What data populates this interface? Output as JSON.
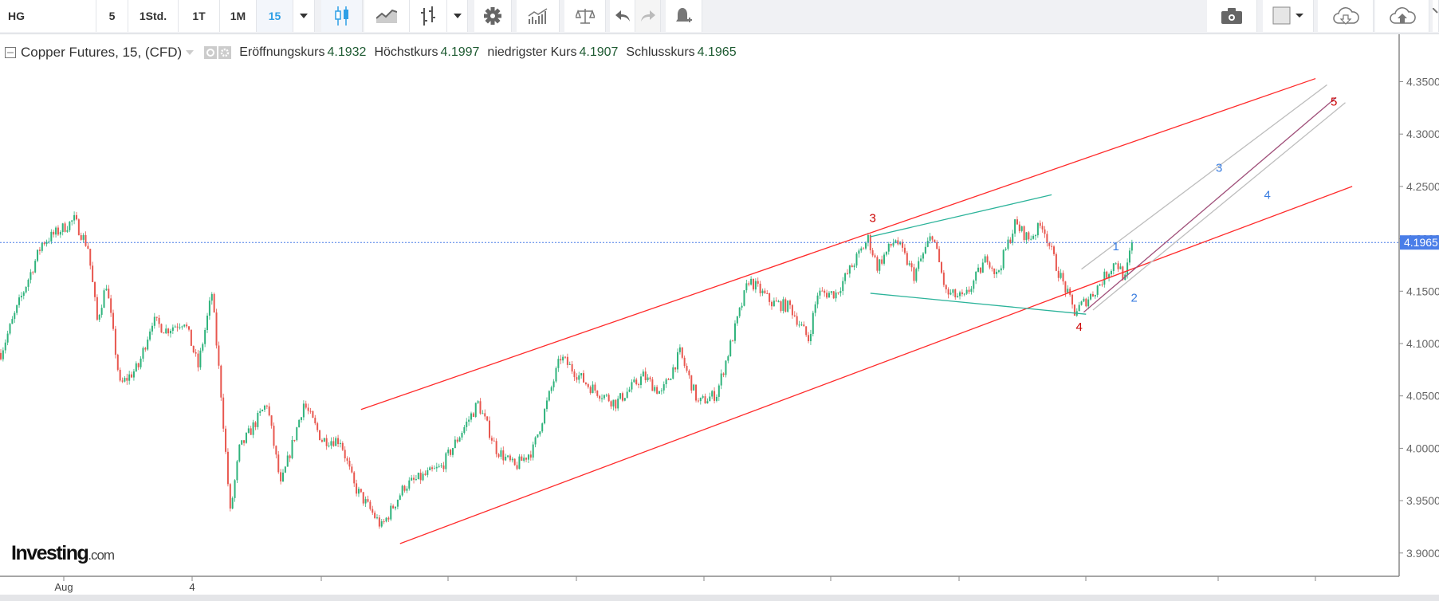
{
  "toolbar": {
    "symbol": "HG",
    "intervals": [
      "5",
      "1Std.",
      "1T",
      "1M",
      "15"
    ],
    "active_interval": "15",
    "icons": [
      "candles-icon",
      "line-chart-icon",
      "bars-icon",
      "gear-icon",
      "indicators-icon",
      "scale-icon",
      "undo-icon",
      "redo-icon",
      "alert-icon",
      "camera-icon",
      "color-icon",
      "cloud-download-icon",
      "cloud-upload-icon",
      "fullscreen-icon"
    ]
  },
  "legend": {
    "title": "Copper Futures, 15, (CFD)",
    "open_label": "Eröffnungskurs",
    "open": "4.1932",
    "high_label": "Höchstkurs",
    "high": "4.1997",
    "low_label": "niedrigster Kurs",
    "low": "4.1907",
    "close_label": "Schlusskurs",
    "close": "4.1965"
  },
  "logo": {
    "main": "Investing",
    "suffix": ".com"
  },
  "colors": {
    "up": "#2fb37c",
    "down": "#e8574f",
    "channel": "#ff2a2a",
    "wedge": "#2bb39a",
    "gray": "#bdbdbd",
    "purple": "#a0507a",
    "current": "#4a7ee8",
    "wave_red": "#cc0000",
    "wave_blue": "#3a7de0"
  },
  "chart_data": {
    "type": "candlestick",
    "title": "Copper Futures, 15, (CFD)",
    "ylim": [
      3.875,
      4.37
    ],
    "yticks": [
      "4.3500",
      "4.3000",
      "4.2500",
      "4.2000",
      "4.1500",
      "4.1000",
      "4.0500",
      "4.0000",
      "3.9500",
      "3.9000"
    ],
    "ytick_values": [
      4.35,
      4.3,
      4.25,
      4.2,
      4.15,
      4.1,
      4.05,
      4.0,
      3.95,
      3.9
    ],
    "xlabels": [
      "Aug",
      "4"
    ],
    "current_price": 4.1965,
    "current_price_label": "4.1965",
    "price_path_approx": [
      [
        0,
        4.091
      ],
      [
        8,
        4.139
      ],
      [
        18,
        4.196
      ],
      [
        32,
        4.218
      ],
      [
        38,
        4.192
      ],
      [
        42,
        4.122
      ],
      [
        46,
        4.157
      ],
      [
        52,
        4.06
      ],
      [
        60,
        4.078
      ],
      [
        66,
        4.122
      ],
      [
        72,
        4.113
      ],
      [
        80,
        4.122
      ],
      [
        86,
        4.078
      ],
      [
        92,
        4.148
      ],
      [
        96,
        4.052
      ],
      [
        100,
        3.938
      ],
      [
        104,
        3.999
      ],
      [
        116,
        4.043
      ],
      [
        122,
        3.964
      ],
      [
        132,
        4.043
      ],
      [
        140,
        4.008
      ],
      [
        148,
        4.008
      ],
      [
        154,
        3.964
      ],
      [
        166,
        3.925
      ],
      [
        176,
        3.964
      ],
      [
        192,
        3.982
      ],
      [
        208,
        4.043
      ],
      [
        216,
        3.999
      ],
      [
        224,
        3.982
      ],
      [
        232,
        3.999
      ],
      [
        244,
        4.087
      ],
      [
        256,
        4.06
      ],
      [
        268,
        4.043
      ],
      [
        280,
        4.069
      ],
      [
        288,
        4.052
      ],
      [
        296,
        4.091
      ],
      [
        304,
        4.043
      ],
      [
        312,
        4.052
      ],
      [
        326,
        4.161
      ],
      [
        336,
        4.139
      ],
      [
        344,
        4.135
      ],
      [
        352,
        4.104
      ],
      [
        356,
        4.148
      ],
      [
        364,
        4.148
      ],
      [
        378,
        4.2
      ],
      [
        382,
        4.174
      ],
      [
        390,
        4.2
      ],
      [
        398,
        4.165
      ],
      [
        406,
        4.205
      ],
      [
        412,
        4.148
      ],
      [
        420,
        4.143
      ],
      [
        430,
        4.183
      ],
      [
        434,
        4.165
      ],
      [
        442,
        4.214
      ],
      [
        448,
        4.2
      ],
      [
        454,
        4.214
      ],
      [
        460,
        4.174
      ],
      [
        468,
        4.13
      ],
      [
        476,
        4.148
      ],
      [
        486,
        4.179
      ],
      [
        490,
        4.161
      ],
      [
        493,
        4.1965
      ]
    ],
    "lines": [
      {
        "name": "upper-channel",
        "color": "channel",
        "from": [
          157,
          4.037
        ],
        "to": [
          573,
          4.353
        ]
      },
      {
        "name": "lower-channel",
        "color": "channel",
        "from": [
          174,
          3.909
        ],
        "to": [
          589,
          4.25
        ]
      },
      {
        "name": "wedge-upper",
        "color": "wedge",
        "from": [
          379,
          4.202
        ],
        "to": [
          458,
          4.242
        ]
      },
      {
        "name": "wedge-lower",
        "color": "wedge",
        "from": [
          379,
          4.148
        ],
        "to": [
          473,
          4.128
        ]
      },
      {
        "name": "gray-upper",
        "color": "gray",
        "from": [
          471,
          4.171
        ],
        "to": [
          578,
          4.347
        ]
      },
      {
        "name": "purple-mid",
        "color": "purple",
        "from": [
          472,
          4.13
        ],
        "to": [
          582,
          4.335
        ]
      },
      {
        "name": "gray-lower",
        "color": "gray",
        "from": [
          476,
          4.132
        ],
        "to": [
          586,
          4.33
        ]
      }
    ],
    "annotations": [
      {
        "text": "3",
        "at": [
          380,
          4.216
        ],
        "color": "wave_red"
      },
      {
        "text": "4",
        "at": [
          470,
          4.112
        ],
        "color": "wave_red"
      },
      {
        "text": "5",
        "at": [
          581,
          4.327
        ],
        "color": "wave_red"
      },
      {
        "text": "1",
        "at": [
          486,
          4.189
        ],
        "color": "wave_blue"
      },
      {
        "text": "2",
        "at": [
          494,
          4.14
        ],
        "color": "wave_blue"
      },
      {
        "text": "3",
        "at": [
          531,
          4.264
        ],
        "color": "wave_blue"
      },
      {
        "text": "4",
        "at": [
          552,
          4.238
        ],
        "color": "wave_blue"
      }
    ]
  }
}
